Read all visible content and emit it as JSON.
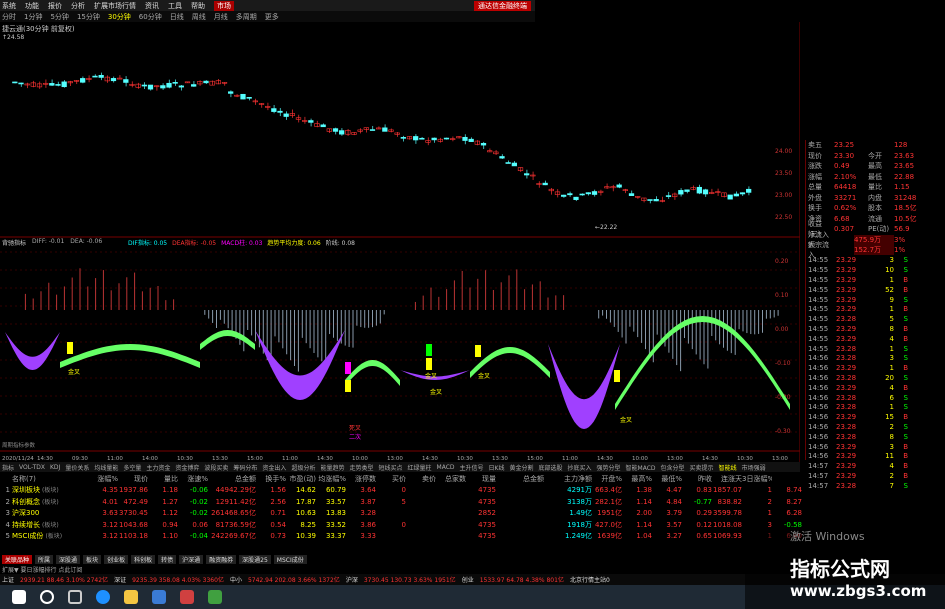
{
  "menu": [
    "系统",
    "功能",
    "报价",
    "分析",
    "扩展市场行情",
    "资讯",
    "工具",
    "帮助"
  ],
  "menu_badge": "市场",
  "alert_text": "通达信金融终端",
  "periods": [
    {
      "label": "分时",
      "sel": false
    },
    {
      "label": "1分钟",
      "sel": false
    },
    {
      "label": "5分钟",
      "sel": false
    },
    {
      "label": "15分钟",
      "sel": false
    },
    {
      "label": "30分钟",
      "sel": true
    },
    {
      "label": "60分钟",
      "sel": false
    },
    {
      "label": "日线",
      "sel": false
    },
    {
      "label": "周线",
      "sel": false
    },
    {
      "label": "月线",
      "sel": false
    },
    {
      "label": "多周期",
      "sel": false
    },
    {
      "label": "更多",
      "sel": false
    }
  ],
  "chart_title": "捷云通(30分钟 前复权)",
  "price_tag": "↑24.58",
  "low_label": "22.22",
  "price_axis": [
    "24.00",
    "23.50",
    "23.00",
    "22.50"
  ],
  "indicator_legend": [
    "背驰指标",
    "DIFF: -0.01",
    "DEA: -0.06"
  ],
  "indicator_legend2": [
    "DIF指标: 0.05",
    "DEA指标: -0.05",
    "MACD柱: 0.03",
    "趋势平均力度: 0.06",
    "阶线: 0.08"
  ],
  "ind_axis": [
    "0.20",
    "0.10",
    "0.00",
    "-0.10",
    "-0.20",
    "-0.30"
  ],
  "ind_labels": [
    {
      "text": "金叉",
      "color": "#ff0"
    },
    {
      "text": "金叉",
      "color": "#ff0"
    },
    {
      "text": "金叉",
      "color": "#ff0"
    },
    {
      "text": "金叉",
      "color": "#ff0"
    },
    {
      "text": "死叉",
      "color": "#f33"
    },
    {
      "text": "二次",
      "color": "#f0f"
    },
    {
      "text": "金叉",
      "color": "#ff0"
    }
  ],
  "bottom_left_text": "周期指标参数",
  "time_axis": [
    "2020/11/24",
    "14:30",
    "09:30",
    "11:00",
    "14:00",
    "10:30",
    "13:30",
    "15:00",
    "11:00",
    "14:30",
    "10:00",
    "13:00",
    "14:30",
    "10:30",
    "13:30",
    "15:00",
    "11:00",
    "14:30",
    "10:00",
    "13:00",
    "14:30",
    "10:30",
    "13:00"
  ],
  "quote": [
    {
      "k": "卖五",
      "v": "23.25",
      "k2": "",
      "v2": "128"
    },
    {
      "k": "现价",
      "v": "23.30",
      "k2": "今开",
      "v2": "23.63"
    },
    {
      "k": "涨跌",
      "v": "0.49",
      "k2": "最高",
      "v2": "23.65"
    },
    {
      "k": "涨幅",
      "v": "2.10%",
      "k2": "最低",
      "v2": "22.88"
    },
    {
      "k": "总量",
      "v": "64418",
      "k2": "量比",
      "v2": "1.15"
    },
    {
      "k": "外盘",
      "v": "33271",
      "k2": "内盘",
      "v2": "31248"
    },
    {
      "k": "换手",
      "v": "0.62%",
      "k2": "股本",
      "v2": "18.5亿"
    },
    {
      "k": "净资",
      "v": "6.68",
      "k2": "流通",
      "v2": "10.5亿"
    },
    {
      "k": "收益(三)",
      "v": "0.307",
      "k2": "PE(动)",
      "v2": "56.9"
    }
  ],
  "flow": [
    {
      "k": "净流入额",
      "v": "475.9万",
      "v2": "3%"
    },
    {
      "k": "大宗流入",
      "v": "152.7万",
      "v2": "1%"
    }
  ],
  "ticks": [
    {
      "t": "14:55",
      "p": "23.29",
      "v": "3",
      "d": "S"
    },
    {
      "t": "14:55",
      "p": "23.29",
      "v": "10",
      "d": "S"
    },
    {
      "t": "14:55",
      "p": "23.29",
      "v": "1",
      "d": "B"
    },
    {
      "t": "14:55",
      "p": "23.29",
      "v": "52",
      "d": "B"
    },
    {
      "t": "14:55",
      "p": "23.29",
      "v": "9",
      "d": "S"
    },
    {
      "t": "14:55",
      "p": "23.29",
      "v": "1",
      "d": "B"
    },
    {
      "t": "14:55",
      "p": "23.28",
      "v": "5",
      "d": "S"
    },
    {
      "t": "14:55",
      "p": "23.29",
      "v": "8",
      "d": "B"
    },
    {
      "t": "14:55",
      "p": "23.29",
      "v": "4",
      "d": "B"
    },
    {
      "t": "14:55",
      "p": "23.28",
      "v": "1",
      "d": "S"
    },
    {
      "t": "14:56",
      "p": "23.28",
      "v": "3",
      "d": "S"
    },
    {
      "t": "14:56",
      "p": "23.29",
      "v": "1",
      "d": "B"
    },
    {
      "t": "14:56",
      "p": "23.28",
      "v": "20",
      "d": "S"
    },
    {
      "t": "14:56",
      "p": "23.29",
      "v": "4",
      "d": "B"
    },
    {
      "t": "14:56",
      "p": "23.28",
      "v": "6",
      "d": "S"
    },
    {
      "t": "14:56",
      "p": "23.28",
      "v": "1",
      "d": "S"
    },
    {
      "t": "14:56",
      "p": "23.29",
      "v": "15",
      "d": "B"
    },
    {
      "t": "14:56",
      "p": "23.28",
      "v": "2",
      "d": "S"
    },
    {
      "t": "14:56",
      "p": "23.28",
      "v": "8",
      "d": "S"
    },
    {
      "t": "14:56",
      "p": "23.29",
      "v": "3",
      "d": "B"
    },
    {
      "t": "14:56",
      "p": "23.29",
      "v": "11",
      "d": "B"
    },
    {
      "t": "14:57",
      "p": "23.29",
      "v": "4",
      "d": "B"
    },
    {
      "t": "14:57",
      "p": "23.29",
      "v": "2",
      "d": "B"
    },
    {
      "t": "14:57",
      "p": "23.28",
      "v": "7",
      "d": "S"
    }
  ],
  "tabs": [
    {
      "label": "指标",
      "sel": false
    },
    {
      "label": "VOL-TDX",
      "sel": false
    },
    {
      "label": "KDJ",
      "sel": false
    },
    {
      "label": "量价关系",
      "sel": false
    },
    {
      "label": "均线量能",
      "sel": false
    },
    {
      "label": "多空量",
      "sel": false
    },
    {
      "label": "主力资金",
      "sel": false
    },
    {
      "label": "资金博弈",
      "sel": false
    },
    {
      "label": "波段买卖",
      "sel": false
    },
    {
      "label": "筹码分布",
      "sel": false
    },
    {
      "label": "资金出入",
      "sel": false
    },
    {
      "label": "超级分析",
      "sel": false
    },
    {
      "label": "能量趋势",
      "sel": false
    },
    {
      "label": "走势类型",
      "sel": false
    },
    {
      "label": "短线买点",
      "sel": false
    },
    {
      "label": "红绿量柱",
      "sel": false
    },
    {
      "label": "MACD",
      "sel": false
    },
    {
      "label": "主升信号",
      "sel": false
    },
    {
      "label": "日K线",
      "sel": false
    },
    {
      "label": "黄金分割",
      "sel": false
    },
    {
      "label": "底部选股",
      "sel": false
    },
    {
      "label": "抄底买入",
      "sel": false
    },
    {
      "label": "强势分型",
      "sel": false
    },
    {
      "label": "智能MACD",
      "sel": false
    },
    {
      "label": "包含分型",
      "sel": false
    },
    {
      "label": "买卖提示",
      "sel": false
    },
    {
      "label": "智能线",
      "sel": true
    },
    {
      "label": "市场强弱",
      "sel": false
    }
  ],
  "table_headers": [
    "",
    "名称(7)",
    "涨幅%",
    "现价",
    "量比",
    "涨速%",
    "总金额",
    "换手%",
    "市盈(动)",
    "均涨幅%",
    "涨停数",
    "买价",
    "卖价",
    "总家数",
    "现量",
    "总金额",
    "主力净额",
    "开盘%",
    "最高%",
    "最低%",
    "昨收",
    "连涨天",
    "3日涨幅%"
  ],
  "table_rows": [
    {
      "i": "1",
      "name": "深圳板块",
      "tag": "(板块)",
      "c": [
        "4.35",
        "1937.86",
        "1.18",
        "-0.06",
        "44942.29亿",
        "1.56",
        "14.62",
        "60.79",
        "3.64",
        "0",
        "",
        "",
        "4735",
        "",
        "4291万",
        "663.4亿",
        "1.38",
        "4.47",
        "0.83",
        "1857.07",
        "1",
        "8.74"
      ]
    },
    {
      "i": "2",
      "name": "科创概念",
      "tag": "(板块)",
      "c": [
        "4.01",
        "472.49",
        "1.27",
        "-0.02",
        "12911.42亿",
        "2.56",
        "17.87",
        "33.57",
        "3.87",
        "5",
        "",
        "",
        "4735",
        "",
        "3138万",
        "282.1亿",
        "1.14",
        "4.84",
        "-0.77",
        "838.82",
        "2",
        "8.27"
      ]
    },
    {
      "i": "3",
      "name": "沪深300",
      "tag": "",
      "c": [
        "3.63",
        "3730.45",
        "1.12",
        "-0.02",
        "261468.65亿",
        "0.71",
        "10.63",
        "13.83",
        "3.28",
        "",
        "",
        "",
        "2852",
        "",
        "1.49亿",
        "1951亿",
        "2.00",
        "3.79",
        "0.29",
        "3599.78",
        "1",
        "6.28"
      ]
    },
    {
      "i": "4",
      "name": "持续增长",
      "tag": "(板块)",
      "c": [
        "3.12",
        "1043.68",
        "0.94",
        "0.06",
        "81736.59亿",
        "0.54",
        "8.25",
        "33.52",
        "3.86",
        "0",
        "",
        "",
        "4735",
        "",
        "1918万",
        "427.0亿",
        "1.14",
        "3.57",
        "0.12",
        "1018.08",
        "3",
        "-0.58"
      ]
    },
    {
      "i": "5",
      "name": "MSCI成份",
      "tag": "(板块)",
      "c": [
        "3.12",
        "1103.18",
        "1.10",
        "-0.04",
        "242269.67亿",
        "0.73",
        "10.39",
        "33.37",
        "3.33",
        "",
        "",
        "",
        "4735",
        "",
        "1.249亿",
        "1639亿",
        "1.04",
        "3.27",
        "0.65",
        "1069.93",
        "1",
        "6.40"
      ]
    }
  ],
  "bottom_tabs": [
    {
      "label": "关联品种",
      "sel": true
    },
    {
      "label": "所属",
      "sel": false
    },
    {
      "label": "深股通",
      "sel": false
    },
    {
      "label": "板块",
      "sel": false
    },
    {
      "label": "创业板",
      "sel": false
    },
    {
      "label": "科创板",
      "sel": false
    },
    {
      "label": "转债",
      "sel": false
    },
    {
      "label": "沪深通",
      "sel": false
    },
    {
      "label": "融资融券",
      "sel": false
    },
    {
      "label": "深股通25",
      "sel": false
    },
    {
      "label": "MSCI成份",
      "sel": false
    }
  ],
  "news_line": "扩展▼ 要日涨幅排行 点此订阅",
  "status": [
    {
      "lbl": "上证",
      "val": "2939.21 88.46 3.10% 2742亿"
    },
    {
      "lbl": "深证",
      "val": "9235.39 358.08 4.03% 3360亿"
    },
    {
      "lbl": "中小",
      "val": "5742.94 202.08 3.66% 1372亿"
    },
    {
      "lbl": "沪深",
      "val": "3730.45 130.73 3.63% 1951亿"
    },
    {
      "lbl": "创业",
      "val": "1533.97 64.78 4.38% 801亿"
    },
    {
      "lbl": "",
      "val": "北京行情主站0"
    }
  ],
  "watermark": {
    "activate": "激活 Windows",
    "title": "指标公式网",
    "url": "www.zbgs3.com"
  },
  "colors": {
    "up": "#ff3333",
    "down": "#55ffff",
    "green_area": "#66ff66",
    "purple_area": "#a040ff",
    "yellow": "#ffff00",
    "grid": "#550000"
  }
}
